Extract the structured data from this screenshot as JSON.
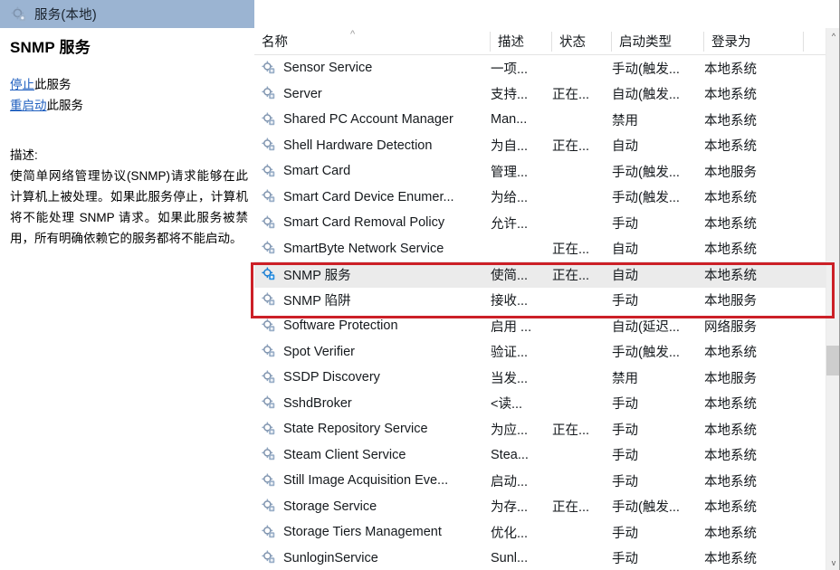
{
  "window": {
    "title": "服务(本地)",
    "title_icon": "gear-services-icon",
    "titlebar_color": "#9bb4d2"
  },
  "left_panel": {
    "service_name": "SNMP 服务",
    "actions": [
      {
        "link": "停止",
        "suffix": "此服务"
      },
      {
        "link": "重启动",
        "suffix": "此服务"
      }
    ],
    "description_label": "描述:",
    "description_text": "使简单网络管理协议(SNMP)请求能够在此计算机上被处理。如果此服务停止，计算机将不能处理 SNMP 请求。如果此服务被禁用，所有明确依赖它的服务都将不能启动。"
  },
  "list": {
    "columns": [
      "名称",
      "描述",
      "状态",
      "启动类型",
      "登录为"
    ],
    "sort_column": "名称",
    "sort_indicator": "^",
    "selected_row": "SNMP 服务",
    "rows": [
      {
        "name": "Sensor Service",
        "desc": "一项...",
        "state": "",
        "start": "手动(触发...",
        "logon": "本地系统",
        "icon": "gear-service-icon"
      },
      {
        "name": "Server",
        "desc": "支持...",
        "state": "正在...",
        "start": "自动(触发...",
        "logon": "本地系统",
        "icon": "gear-service-icon"
      },
      {
        "name": "Shared PC Account Manager",
        "desc": "Man...",
        "state": "",
        "start": "禁用",
        "logon": "本地系统",
        "icon": "gear-service-icon"
      },
      {
        "name": "Shell Hardware Detection",
        "desc": "为自...",
        "state": "正在...",
        "start": "自动",
        "logon": "本地系统",
        "icon": "gear-service-icon"
      },
      {
        "name": "Smart Card",
        "desc": "管理...",
        "state": "",
        "start": "手动(触发...",
        "logon": "本地服务",
        "icon": "gear-service-icon"
      },
      {
        "name": "Smart Card Device Enumer...",
        "desc": "为给...",
        "state": "",
        "start": "手动(触发...",
        "logon": "本地系统",
        "icon": "gear-service-icon"
      },
      {
        "name": "Smart Card Removal Policy",
        "desc": "允许...",
        "state": "",
        "start": "手动",
        "logon": "本地系统",
        "icon": "gear-service-icon"
      },
      {
        "name": "SmartByte Network Service",
        "desc": "",
        "state": "正在...",
        "start": "自动",
        "logon": "本地系统",
        "icon": "gear-service-icon"
      },
      {
        "name": "SNMP 服务",
        "desc": "使简...",
        "state": "正在...",
        "start": "自动",
        "logon": "本地系统",
        "icon": "gear-service-running-icon"
      },
      {
        "name": "SNMP 陷阱",
        "desc": "接收...",
        "state": "",
        "start": "手动",
        "logon": "本地服务",
        "icon": "gear-service-icon"
      },
      {
        "name": "Software Protection",
        "desc": "启用 ...",
        "state": "",
        "start": "自动(延迟...",
        "logon": "网络服务",
        "icon": "gear-service-icon"
      },
      {
        "name": "Spot Verifier",
        "desc": "验证...",
        "state": "",
        "start": "手动(触发...",
        "logon": "本地系统",
        "icon": "gear-service-icon"
      },
      {
        "name": "SSDP Discovery",
        "desc": "当发...",
        "state": "",
        "start": "禁用",
        "logon": "本地服务",
        "icon": "gear-service-icon"
      },
      {
        "name": "SshdBroker",
        "desc": "<读...",
        "state": "",
        "start": "手动",
        "logon": "本地系统",
        "icon": "gear-service-icon"
      },
      {
        "name": "State Repository Service",
        "desc": "为应...",
        "state": "正在...",
        "start": "手动",
        "logon": "本地系统",
        "icon": "gear-service-icon"
      },
      {
        "name": "Steam Client Service",
        "desc": "Stea...",
        "state": "",
        "start": "手动",
        "logon": "本地系统",
        "icon": "gear-service-icon"
      },
      {
        "name": "Still Image Acquisition Eve...",
        "desc": "启动...",
        "state": "",
        "start": "手动",
        "logon": "本地系统",
        "icon": "gear-service-icon"
      },
      {
        "name": "Storage Service",
        "desc": "为存...",
        "state": "正在...",
        "start": "手动(触发...",
        "logon": "本地系统",
        "icon": "gear-service-icon"
      },
      {
        "name": "Storage Tiers Management",
        "desc": "优化...",
        "state": "",
        "start": "手动",
        "logon": "本地系统",
        "icon": "gear-service-icon"
      },
      {
        "name": "SunloginService",
        "desc": "Sunl...",
        "state": "",
        "start": "手动",
        "logon": "本地系统",
        "icon": "gear-service-icon"
      }
    ]
  },
  "scrollbar": {
    "up_arrow": "^",
    "down_arrow": "v"
  },
  "annotation": {
    "color": "#cc2027",
    "highlights": [
      "SNMP 服务",
      "SNMP 陷阱"
    ]
  }
}
